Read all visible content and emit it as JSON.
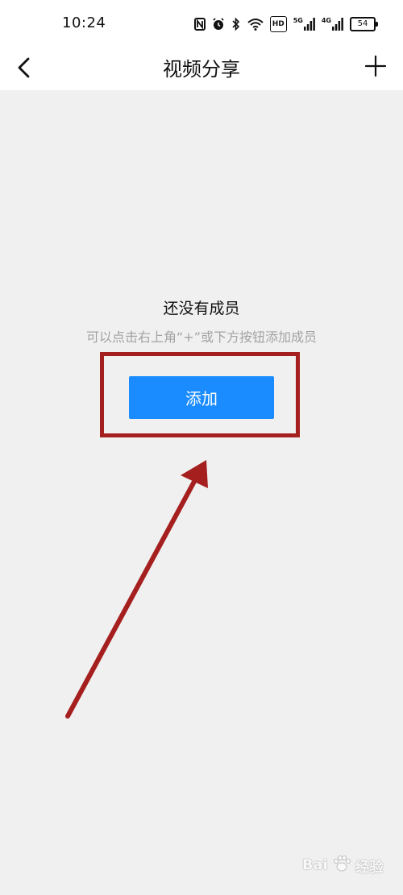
{
  "status_bar": {
    "time": "10:24",
    "signal1_label": "5G",
    "signal2_label": "4G",
    "hd_label": "HD",
    "battery": "54"
  },
  "nav": {
    "title": "视频分享",
    "back_icon": "chevron-left-icon",
    "plus_icon": "plus-icon"
  },
  "empty_state": {
    "title": "还没有成员",
    "hint": "可以点击右上角“+”或下方按钮添加成员",
    "add_button_label": "添加"
  },
  "watermark": {
    "brand": "Bai",
    "suffix": "经验"
  },
  "colors": {
    "accent": "#1a8cff",
    "annotation": "#a61f1f",
    "background": "#f0f0f0"
  }
}
